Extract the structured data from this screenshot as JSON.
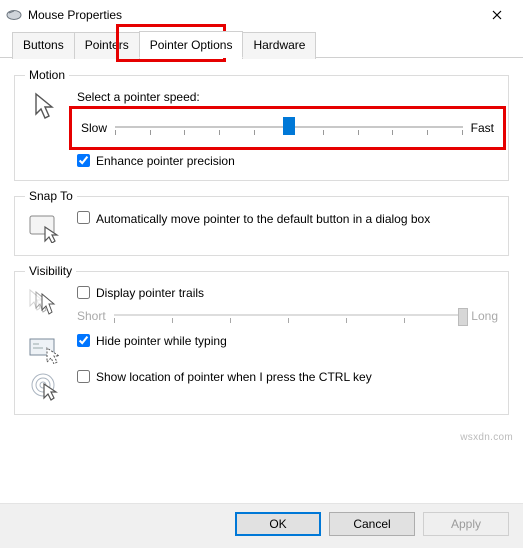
{
  "window": {
    "title": "Mouse Properties"
  },
  "tabs": {
    "buttons": "Buttons",
    "pointers": "Pointers",
    "pointer_options": "Pointer Options",
    "hardware": "Hardware"
  },
  "motion": {
    "legend": "Motion",
    "speed_label": "Select a pointer speed:",
    "slow": "Slow",
    "fast": "Fast",
    "speed_value": 6,
    "speed_min": 1,
    "speed_max": 11,
    "enhance_label": "Enhance pointer precision",
    "enhance_checked": true
  },
  "snap": {
    "legend": "Snap To",
    "auto_label": "Automatically move pointer to the default button in a dialog box",
    "auto_checked": false
  },
  "visibility": {
    "legend": "Visibility",
    "trails_label": "Display pointer trails",
    "trails_checked": false,
    "short": "Short",
    "long": "Long",
    "trails_value": 7,
    "hide_label": "Hide pointer while typing",
    "hide_checked": true,
    "ctrl_label": "Show location of pointer when I press the CTRL key",
    "ctrl_checked": false
  },
  "buttons_bar": {
    "ok": "OK",
    "cancel": "Cancel",
    "apply": "Apply"
  },
  "watermark": "wsxdn.com"
}
